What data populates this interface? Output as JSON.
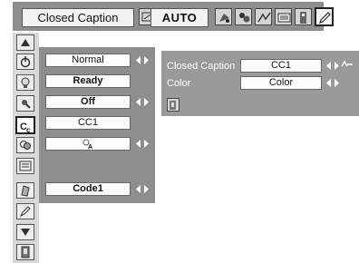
{
  "header": {
    "title": "Closed Caption",
    "mode": "AUTO",
    "icons": [
      "image-adjust-icon",
      "palette-icon",
      "camera-icon",
      "picture-icon",
      "screen-icon",
      "setting-icon",
      "pencil-icon"
    ]
  },
  "sidebar": {
    "icons": [
      "up-arrow-icon",
      "power-icon",
      "light-bulb-icon",
      "lamp-icon",
      "closed-caption-icon",
      "filter-icon",
      "screen-resize-icon",
      "edit-icon",
      "pen-icon",
      "down-arrow-icon",
      "exit-icon"
    ],
    "selected": "closed-caption-icon"
  },
  "main": {
    "rows": [
      {
        "value": "Normal",
        "bold": false,
        "arrows": true
      },
      {
        "value": "Ready",
        "bold": true,
        "arrows": false
      },
      {
        "value": "Off",
        "bold": true,
        "arrows": true
      },
      {
        "value": "CC1",
        "bold": false,
        "arrows": false
      },
      {
        "value": "",
        "bold": false,
        "arrows": true,
        "icon": "lamp-small-icon"
      },
      {
        "value": "Code1",
        "bold": true,
        "arrows": true
      }
    ]
  },
  "submenu": {
    "closed_caption_label": "Closed Caption",
    "closed_caption_value": "CC1",
    "color_label": "Color",
    "color_value": "Color"
  },
  "colors": {
    "panel": "#8e8e8e",
    "sidebar": "#d8d8d8",
    "field": "#fdfdfd"
  }
}
